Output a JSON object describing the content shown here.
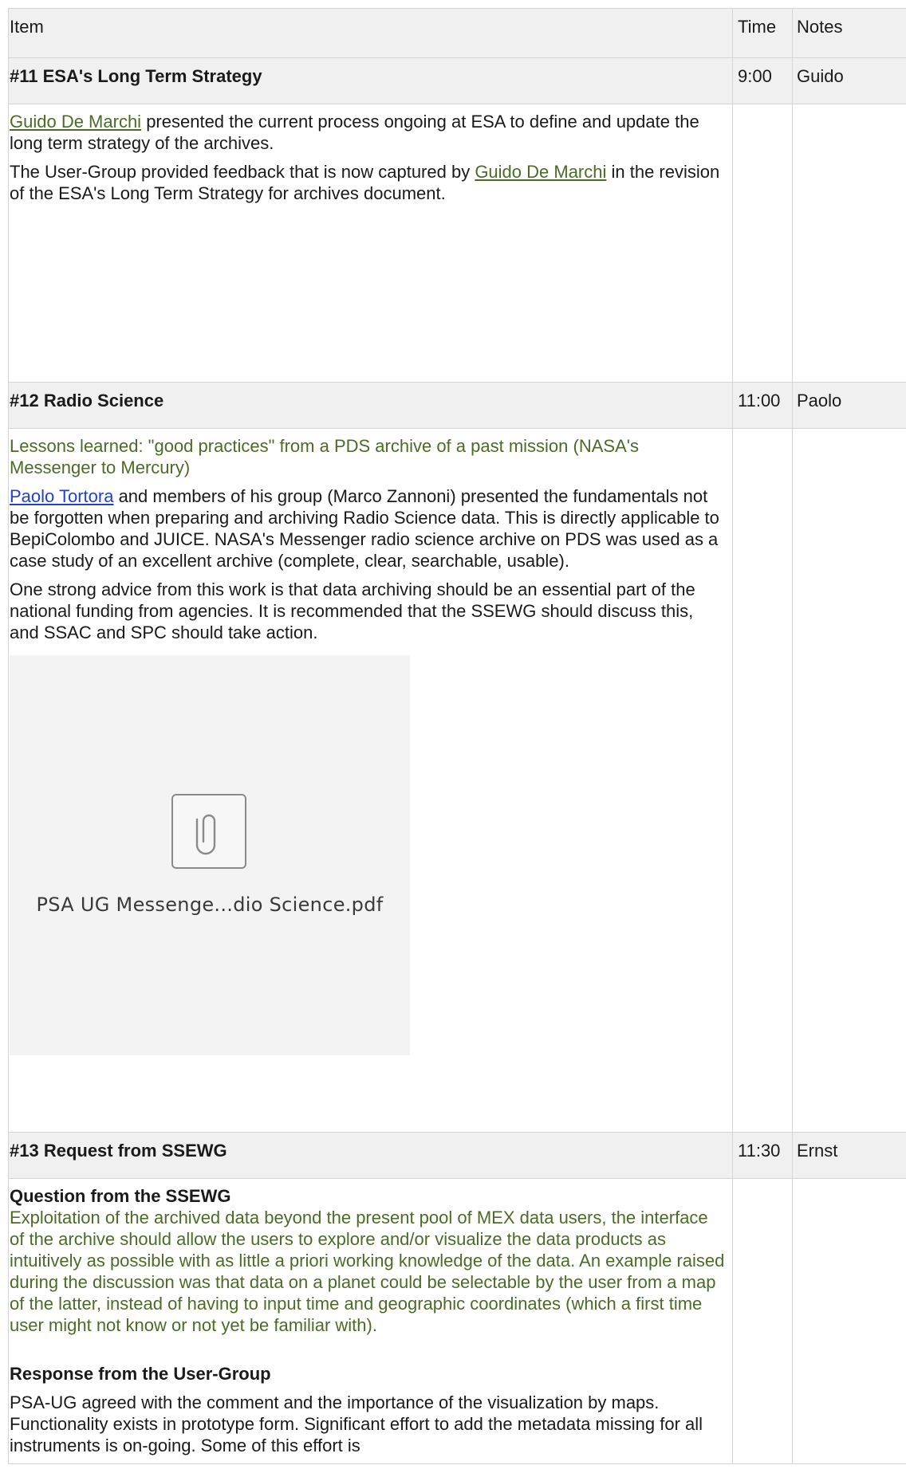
{
  "header": {
    "item": "Item",
    "time": "Time",
    "notes": "Notes"
  },
  "section11": {
    "title": "#11 ESA's Long Term Strategy",
    "time": "9:00",
    "notes": "Guido",
    "p1_link": "Guido De Marchi",
    "p1_text": " presented the current process ongoing at ESA to define and update the long term strategy of the archives.",
    "p2_text": "The User-Group provided feedback that is now captured by ",
    "p2_link": "Guido De Marchi",
    "p2_tail": " in the revision of the ESA's Long Term Strategy for archives document."
  },
  "section12": {
    "title": "#12 Radio Science",
    "time": "11:00",
    "notes": "Paolo",
    "lessons": "Lessons learned: \"good practices\" from a PDS archive of a past mission (NASA's Messenger to Mercury)",
    "p1_link": "Paolo Tortora",
    "p1_text": " and members of his group (Marco Zannoni) presented the fundamentals not be forgotten when preparing and archiving Radio Science data. This is directly applicable to BepiColombo and JUICE. NASA's Messenger radio science archive on PDS was used as a case study of an excellent archive (complete, clear, searchable, usable).",
    "p2_text": "One strong advice from this work is that data archiving should be an essential part of the national funding from agencies. It is recommended that the SSEWG should discuss this,  and SSAC and SPC should take action.",
    "attachment_name": "PSA UG Messenge...dio Science.pdf",
    "attachment_icon": "paperclip-icon"
  },
  "section13": {
    "title": "#13 Request from SSEWG",
    "time": "11:30",
    "notes": "Ernst",
    "question_heading": "Question from the SSEWG",
    "question_text": "Exploitation of the archived data beyond the present pool of MEX data users, the interface of the archive should allow the users to explore and/or visualize the data products as intuitively as possible with as little a priori working knowledge of the data. An example raised during the discussion was that data on a planet could be selectable by the user from a map of the latter, instead of having to input time and geographic coordinates (which a first time user might not know or not yet be familiar with).",
    "response_heading": "Response from the User-Group",
    "response_text": "PSA-UG agreed with the comment and the importance of the visualization by maps. Functionality exists in prototype form. Significant effort to add the metadata missing for all instruments is on-going. Some of this effort is"
  },
  "colors": {
    "link_green": "#4b6b26",
    "link_blue": "#1f3fd6",
    "header_bg": "#f0f0f0",
    "border": "#d4d4d4"
  }
}
